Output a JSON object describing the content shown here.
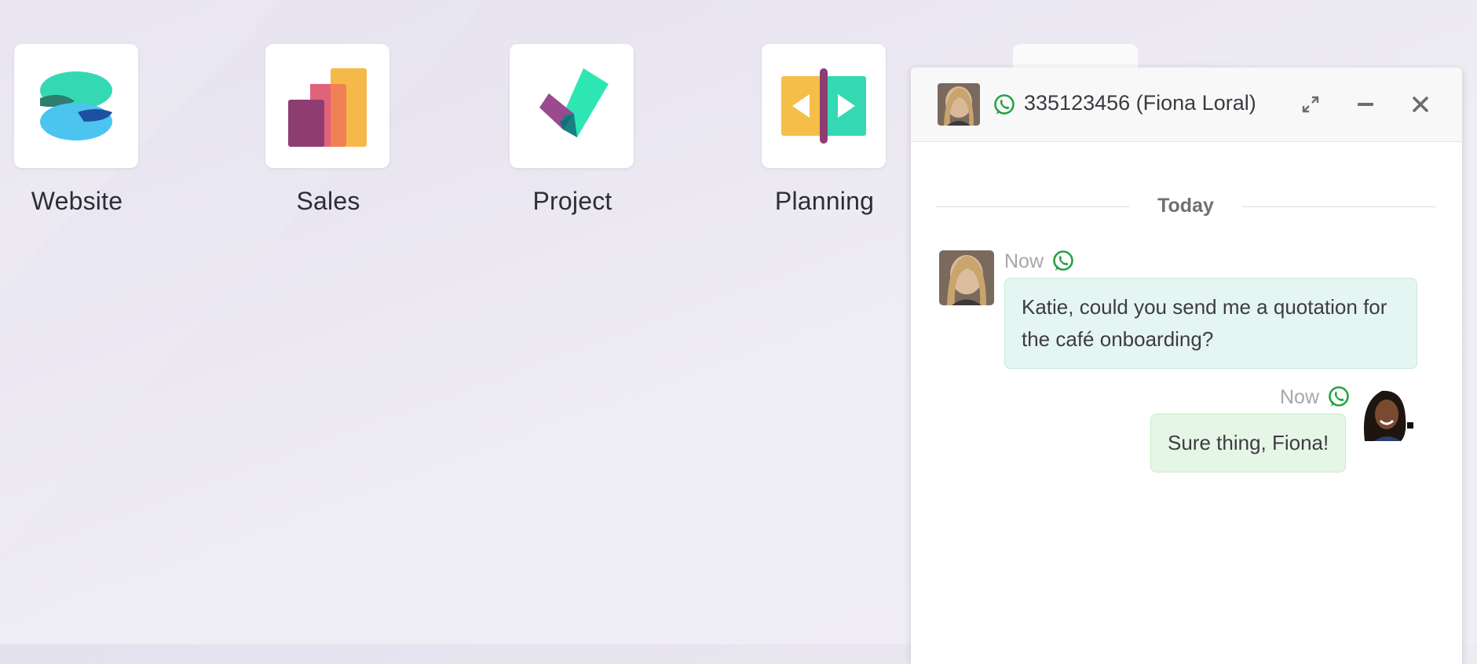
{
  "apps": [
    {
      "id": "website",
      "label": "Website",
      "icon": "website-icon"
    },
    {
      "id": "sales",
      "label": "Sales",
      "icon": "sales-icon"
    },
    {
      "id": "project",
      "label": "Project",
      "icon": "project-icon"
    },
    {
      "id": "planning",
      "label": "Planning",
      "icon": "planning-icon"
    }
  ],
  "chat": {
    "title": "335123456 (Fiona Loral)",
    "divider_label": "Today",
    "messages": [
      {
        "direction": "incoming",
        "time": "Now",
        "channel": "whatsapp-icon",
        "text": "Katie, could you send me a quotation for the café onboarding?"
      },
      {
        "direction": "outgoing",
        "time": "Now",
        "channel": "whatsapp-icon",
        "text": "Sure thing, Fiona!"
      }
    ],
    "header_buttons": [
      "expand-icon",
      "minimize-icon",
      "close-icon"
    ]
  },
  "colors": {
    "whatsapp_green": "#25a244",
    "incoming_bubble": "#e5f5f2",
    "outgoing_bubble": "#e6f6e6"
  }
}
